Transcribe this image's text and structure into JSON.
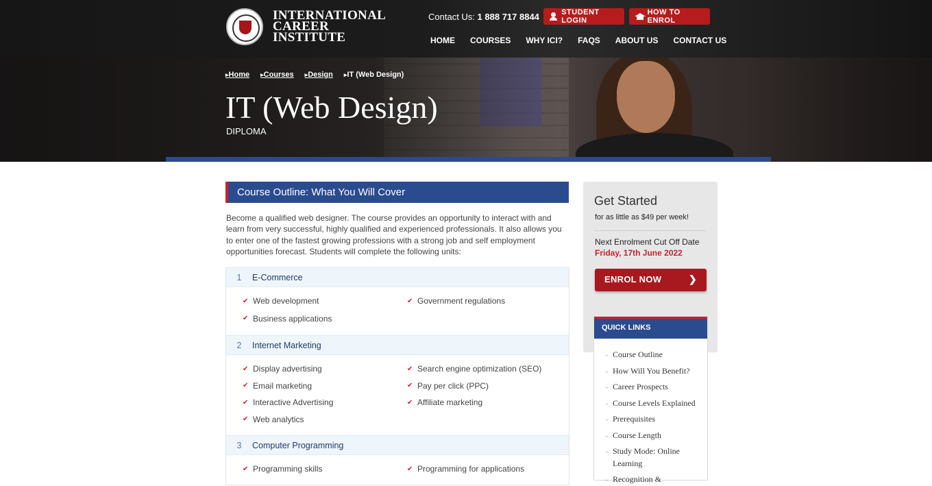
{
  "header": {
    "logo_lines": [
      "INTERNATIONAL",
      "CAREER",
      "INSTITUTE"
    ],
    "contact_label": "Contact Us:",
    "contact_phone": "1 888 717 8844",
    "student_login": "STUDENT LOGIN",
    "how_to_enrol": "HOW TO ENROL",
    "nav": [
      "HOME",
      "COURSES",
      "WHY ICI?",
      "FAQS",
      "ABOUT US",
      "CONTACT US"
    ]
  },
  "hero": {
    "breadcrumb": [
      "Home",
      "Courses",
      "Design",
      "IT (Web Design)"
    ],
    "title": "IT (Web Design)",
    "subtitle": "DIPLOMA"
  },
  "main": {
    "outline_heading": "Course Outline: What You Will Cover",
    "intro": "Become a qualified web designer. The course provides an opportunity to interact with and learn from very successful, highly qualified and experienced professionals. It also allows you to enter one of the fastest growing professions with a strong job and self employment opportunities forecast. Students will complete the following units:",
    "units": [
      {
        "num": "1",
        "title": "E-Commerce",
        "col1": [
          "Web development",
          "Business applications"
        ],
        "col2": [
          "Government regulations"
        ]
      },
      {
        "num": "2",
        "title": "Internet Marketing",
        "col1": [
          "Display advertising",
          "Email marketing",
          "Interactive Advertising",
          "Web analytics"
        ],
        "col2": [
          "Search engine optimization (SEO)",
          "Pay per click (PPC)",
          "Affiliate marketing"
        ]
      },
      {
        "num": "3",
        "title": "Computer Programming",
        "col1": [
          "Programming skills"
        ],
        "col2": [
          "Programming for applications"
        ]
      }
    ]
  },
  "sidebar": {
    "title": "Get Started",
    "price": "for as little as $49 per week!",
    "cutoff_label": "Next Enrolment Cut Off Date",
    "cutoff_date": "Friday, 17th June 2022",
    "enrol_button": "ENROL NOW",
    "quick_links_title": "QUICK LINKS",
    "quick_links": [
      "Course Outline",
      "How Will You Benefit?",
      "Career Prospects",
      "Course Levels Explained",
      "Prerequisites",
      "Course Length",
      "Study Mode: Online Learning",
      "Recognition &"
    ]
  },
  "colors": {
    "brand_red": "#b71c1c",
    "brand_blue": "#2b4b8f"
  }
}
